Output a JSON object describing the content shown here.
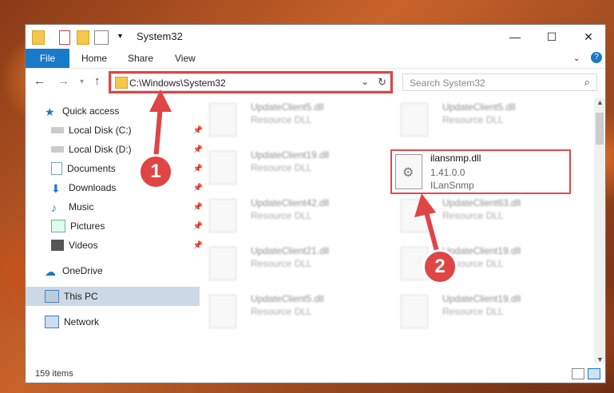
{
  "window": {
    "title": "System32"
  },
  "ribbon": {
    "file": "File",
    "home": "Home",
    "share": "Share",
    "view": "View"
  },
  "address": {
    "path": "C:\\Windows\\System32",
    "search_placeholder": "Search System32"
  },
  "sidebar": {
    "items": [
      {
        "label": "Quick access"
      },
      {
        "label": "Local Disk (C:)"
      },
      {
        "label": "Local Disk (D:)"
      },
      {
        "label": "Documents"
      },
      {
        "label": "Downloads"
      },
      {
        "label": "Music"
      },
      {
        "label": "Pictures"
      },
      {
        "label": "Videos"
      },
      {
        "label": "OneDrive"
      },
      {
        "label": "This PC"
      },
      {
        "label": "Network"
      }
    ]
  },
  "files": [
    {
      "name": "UpdateClient5.dll",
      "desc": "Resource DLL"
    },
    {
      "name": "UpdateClient5.dll",
      "desc": "Resource DLL"
    },
    {
      "name": "UpdateClient19.dll",
      "desc": "Resource DLL"
    },
    {
      "name": "UpdateClient42.dll",
      "desc": "Resource DLL"
    },
    {
      "name": "UpdateClient63.dll",
      "desc": "Resource DLL"
    },
    {
      "name": "UpdateClient21.dll",
      "desc": "Resource DLL"
    },
    {
      "name": "UpdateClient19.dll",
      "desc": "Resource DLL"
    },
    {
      "name": "UpdateClient5.dll",
      "desc": "Resource DLL"
    },
    {
      "name": "UpdateClient19.dll",
      "desc": "Resource DLL"
    }
  ],
  "highlighted_file": {
    "name": "ilansnmp.dll",
    "version": "1.41.0.0",
    "desc": "ILanSnmp"
  },
  "annotations": {
    "badge1": "1",
    "badge2": "2"
  },
  "status": {
    "items": "159 items"
  },
  "colors": {
    "accent": "#1979ca",
    "annotation": "#e04545"
  }
}
